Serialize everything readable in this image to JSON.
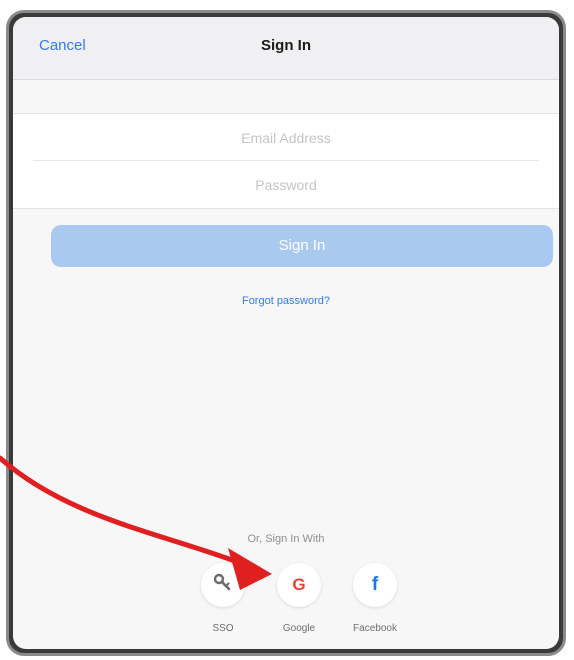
{
  "navbar": {
    "cancel_label": "Cancel",
    "title": "Sign In"
  },
  "form": {
    "email_placeholder": "Email Address",
    "email_value": "",
    "password_placeholder": "Password",
    "password_value": "",
    "signin_label": "Sign In",
    "forgot_label": "Forgot password?"
  },
  "social": {
    "heading": "Or, Sign In With",
    "items": [
      {
        "label": "SSO",
        "icon": "key-icon"
      },
      {
        "label": "Google",
        "icon": "google-icon"
      },
      {
        "label": "Facebook",
        "icon": "facebook-icon"
      }
    ]
  },
  "colors": {
    "accent": "#2f7bf6",
    "signin_button": "#a9c9f1",
    "annotation_arrow": "#e02020"
  }
}
